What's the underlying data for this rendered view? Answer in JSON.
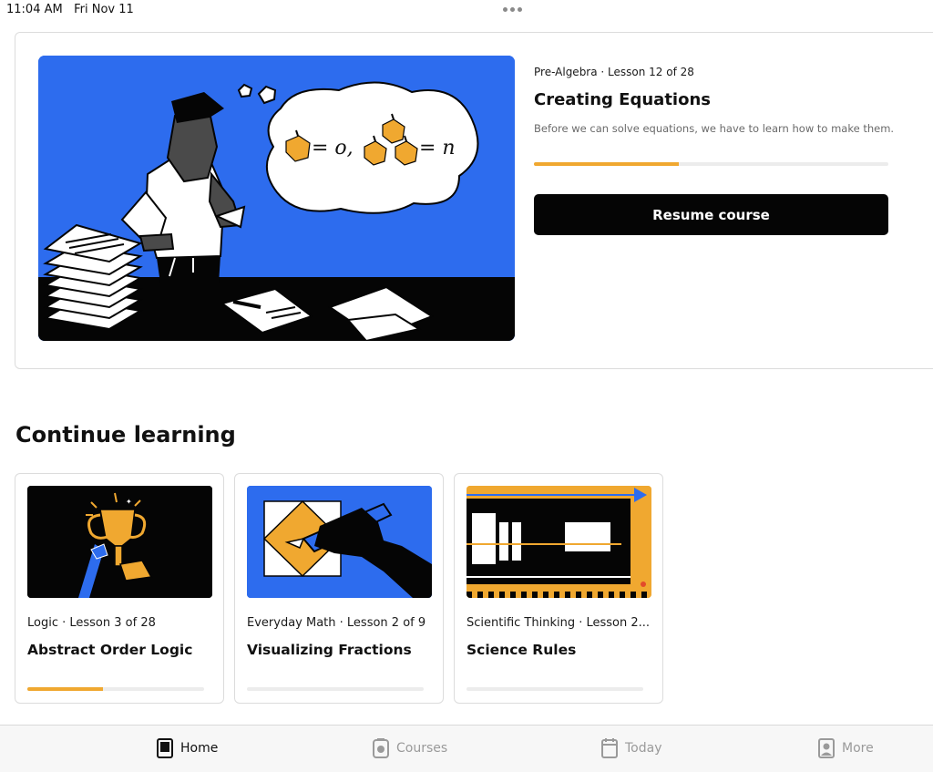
{
  "status_bar": {
    "time_date": "11:04 AM   Fri Nov 11"
  },
  "hero": {
    "meta": "Pre-Algebra · Lesson 12 of 28",
    "title": "Creating Equations",
    "description": "Before we can solve equations, we have to learn how to make them.",
    "progress": 0.41,
    "button_label": "Resume course",
    "equation_first": "= o,",
    "equation_second": "= n",
    "colors": {
      "art_background": "#2d6cee",
      "accent": "#f0a830"
    }
  },
  "continue_learning": {
    "heading": "Continue learning",
    "cards": [
      {
        "meta": "Logic · Lesson 3 of 28",
        "title": "Abstract Order Logic",
        "progress": 0.43,
        "icon": "trophy-icon"
      },
      {
        "meta": "Everyday Math · Lesson 2 of 9",
        "title": "Visualizing Fractions",
        "progress": 0.0,
        "icon": "pen-icon"
      },
      {
        "meta": "Scientific Thinking · Lesson 2...",
        "title": "Science Rules",
        "progress": 0.0,
        "icon": "train-icon"
      }
    ]
  },
  "tab_bar": {
    "tabs": [
      {
        "label": "Home",
        "icon": "home-icon",
        "active": true
      },
      {
        "label": "Courses",
        "icon": "courses-icon",
        "active": false
      },
      {
        "label": "Today",
        "icon": "calendar-icon",
        "active": false
      },
      {
        "label": "More",
        "icon": "profile-icon",
        "active": false
      }
    ]
  }
}
